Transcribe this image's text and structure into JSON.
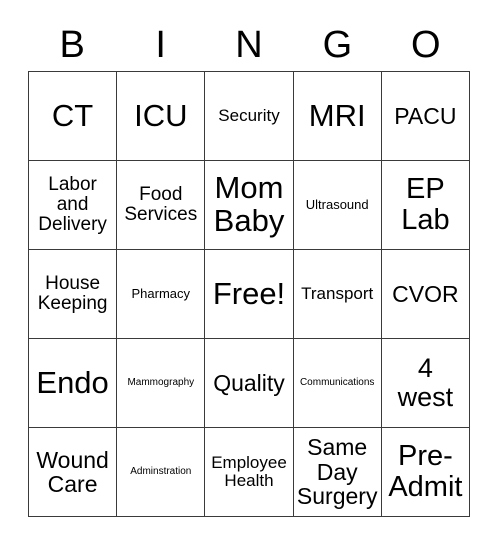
{
  "card": {
    "title": "BINGO Card",
    "header_letters": [
      "B",
      "I",
      "N",
      "G",
      "O"
    ],
    "rows": [
      [
        {
          "text": "CT",
          "size": "fs-xxl"
        },
        {
          "text": "ICU",
          "size": "fs-xxl"
        },
        {
          "text": "Security",
          "size": "fs-xs"
        },
        {
          "text": "MRI",
          "size": "fs-xxl"
        },
        {
          "text": "PACU",
          "size": "fs-md"
        }
      ],
      [
        {
          "text": "Labor\nand\nDelivery",
          "size": "fs-sm"
        },
        {
          "text": "Food\nServices",
          "size": "fs-sm"
        },
        {
          "text": "Mom\nBaby",
          "size": "fs-xxl"
        },
        {
          "text": "Ultrasound",
          "size": "fs-xxs"
        },
        {
          "text": "EP\nLab",
          "size": "fs-xl"
        }
      ],
      [
        {
          "text": "House\nKeeping",
          "size": "fs-sm"
        },
        {
          "text": "Pharmacy",
          "size": "fs-xxs"
        },
        {
          "text": "Free!",
          "size": "fs-xxl"
        },
        {
          "text": "Transport",
          "size": "fs-xs"
        },
        {
          "text": "CVOR",
          "size": "fs-md"
        }
      ],
      [
        {
          "text": "Endo",
          "size": "fs-xxl"
        },
        {
          "text": "Mammography",
          "size": "fs-min"
        },
        {
          "text": "Quality",
          "size": "fs-md"
        },
        {
          "text": "Communications",
          "size": "fs-min"
        },
        {
          "text": "4\nwest",
          "size": "fs-lg"
        }
      ],
      [
        {
          "text": "Wound\nCare",
          "size": "fs-md"
        },
        {
          "text": "Adminstration",
          "size": "fs-min"
        },
        {
          "text": "Employee\nHealth",
          "size": "fs-xs"
        },
        {
          "text": "Same\nDay\nSurgery",
          "size": "fs-md"
        },
        {
          "text": "Pre-\nAdmit",
          "size": "fs-xl"
        }
      ]
    ]
  },
  "colors": {
    "background": "#ffffff",
    "text": "#000000",
    "border": "#3a3a3a"
  }
}
